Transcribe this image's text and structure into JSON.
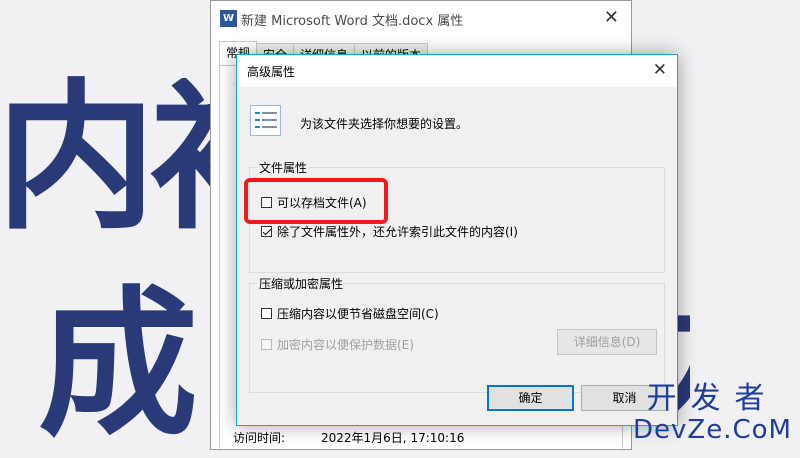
{
  "background": {
    "chars": [
      "内",
      "衫",
      "成",
      "力"
    ],
    "watermark_top": "开发者",
    "watermark_bottom": "DevZe.CoM"
  },
  "back_window": {
    "icon_label": "W",
    "title": "新建 Microsoft Word 文档.docx 属性",
    "close_glyph": "✕",
    "tabs": [
      "常规",
      "安全",
      "详细信息",
      "以前的版本"
    ],
    "access_time_label": "访问时间:",
    "access_time_value": "2022年1月6日, 17:10:16"
  },
  "dialog": {
    "title": "高级属性",
    "close_glyph": "✕",
    "instruction": "为该文件夹选择你想要的设置。",
    "file_attributes": {
      "title": "文件属性",
      "archive": {
        "label": "可以存档文件(A)",
        "checked": false
      },
      "index": {
        "label": "除了文件属性外，还允许索引此文件的内容(I)",
        "checked": true
      }
    },
    "compress_encrypt": {
      "title": "压缩或加密属性",
      "compress": {
        "label": "压缩内容以便节省磁盘空间(C)",
        "checked": false
      },
      "encrypt": {
        "label": "加密内容以便保护数据(E)",
        "checked": false,
        "disabled": true
      },
      "details_button": "详细信息(D)"
    },
    "ok_button": "确定",
    "cancel_button": "取消"
  },
  "colors": {
    "accent": "#0078d7",
    "dialog_border": "#1aa7c7",
    "highlight": "#f0191b",
    "background_text": "#2a3a78",
    "watermark": "#1f3d9c"
  }
}
